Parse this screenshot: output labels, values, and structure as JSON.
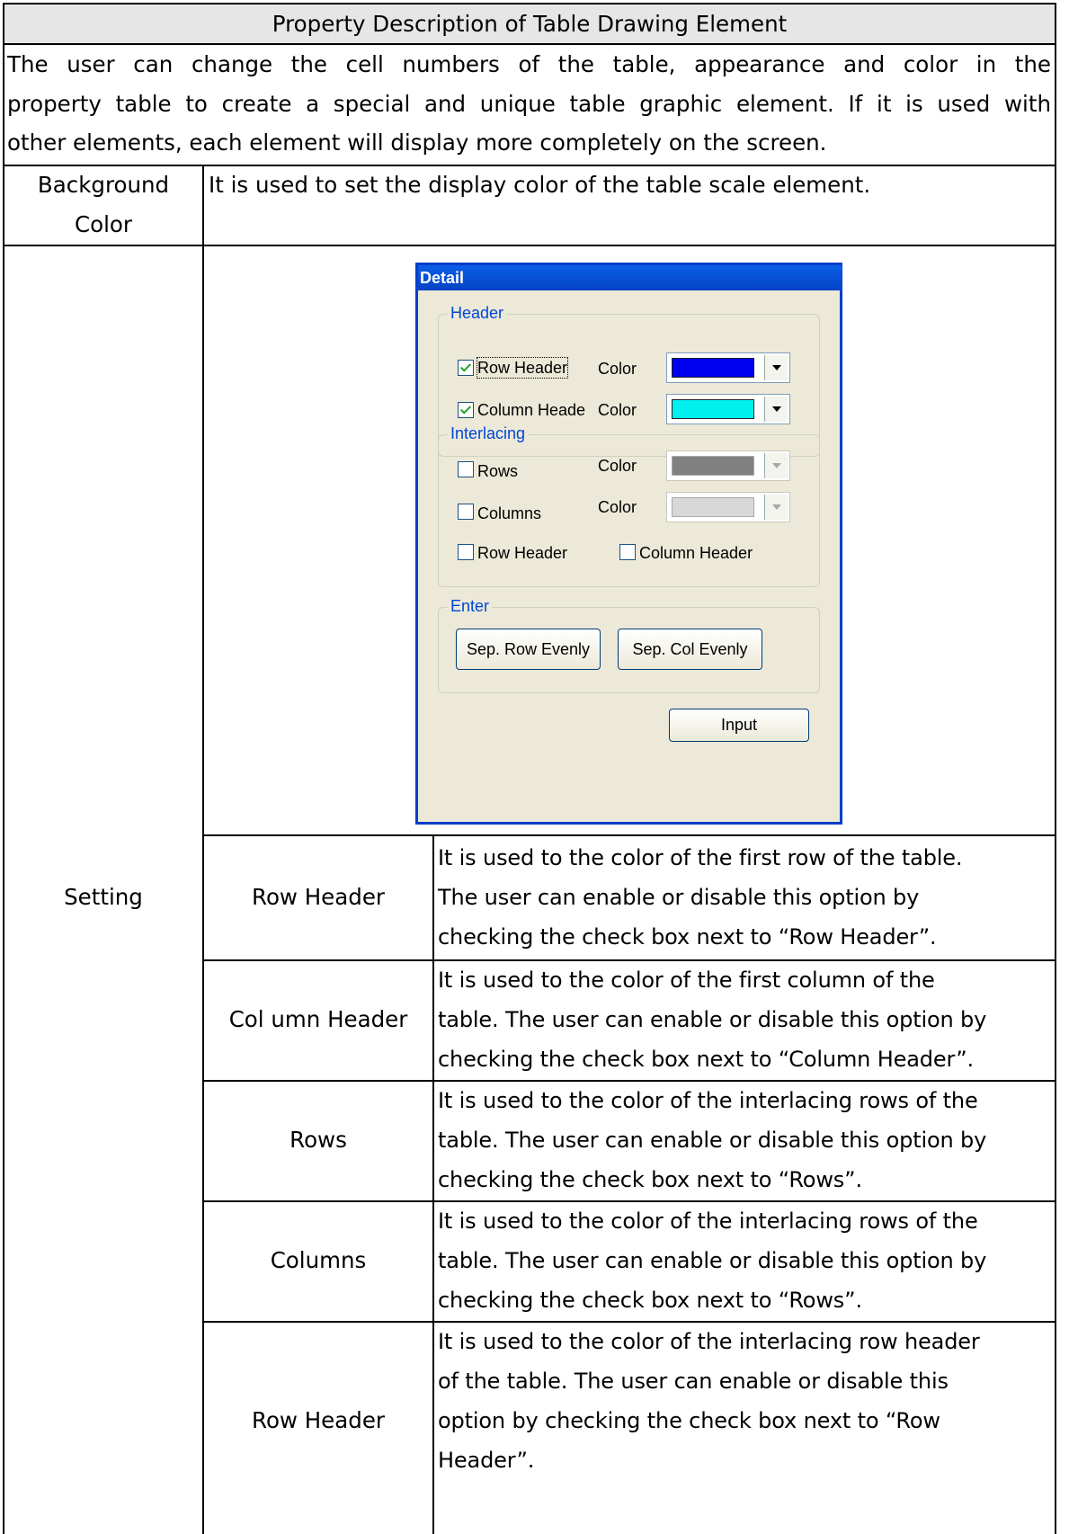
{
  "title": "Property Description of Table Drawing Element",
  "intro_lines": [
    "The user can change the cell numbers of the table, appearance and color in the",
    "property table to create a special and unique table graphic element. If it is used with",
    "other elements, each element will display more completely on the screen."
  ],
  "background_color": {
    "label_line1": "Background",
    "label_line2": "Color",
    "description": "It is used to set the display color of the table scale element."
  },
  "setting_label": "Setting",
  "dialog": {
    "title": "Detail",
    "header_group": "Header",
    "row_header_label": "Row Header",
    "column_header_label": "Column Heade",
    "color_label": "Color",
    "row_header_color": "#0000f0",
    "column_header_color": "#00f0f0",
    "interlacing_group": "Interlacing",
    "rows_label": "Rows",
    "columns_label": "Columns",
    "rows_color": "#808080",
    "columns_color": "#d8d8d8",
    "interlace_row_header_label": "Row Header",
    "interlace_column_header_label": "Column Header",
    "enter_group": "Enter",
    "sep_row_button": "Sep. Row Evenly",
    "sep_col_button": "Sep. Col Evenly",
    "input_button": "Input"
  },
  "settings": [
    {
      "name": "Row Header",
      "lines": [
        "It is used to the color of the first row of the table.",
        "The user can enable or disable this option by",
        "checking the check box next to “Row Header”."
      ]
    },
    {
      "name": "Col umn Header",
      "lines": [
        "It is used to the color of the first column of the",
        "table. The user can enable or disable this option by",
        "checking the check box next to “Column Header”."
      ]
    },
    {
      "name": "Rows",
      "lines": [
        "It is used to the color of the interlacing rows of the",
        "table. The user can enable or disable this option by",
        "checking the check box next to “Rows”."
      ]
    },
    {
      "name": "Columns",
      "lines": [
        "It is used to the color of the interlacing rows of the",
        "table. The user can enable or disable this option by",
        "checking the check box next to “Rows”."
      ]
    },
    {
      "name": "Row Header",
      "lines": [
        "It is used to the color of the interlacing row header",
        "of the table. The user can enable or disable this",
        "option by checking the check box next to “Row",
        "Header”."
      ]
    }
  ]
}
